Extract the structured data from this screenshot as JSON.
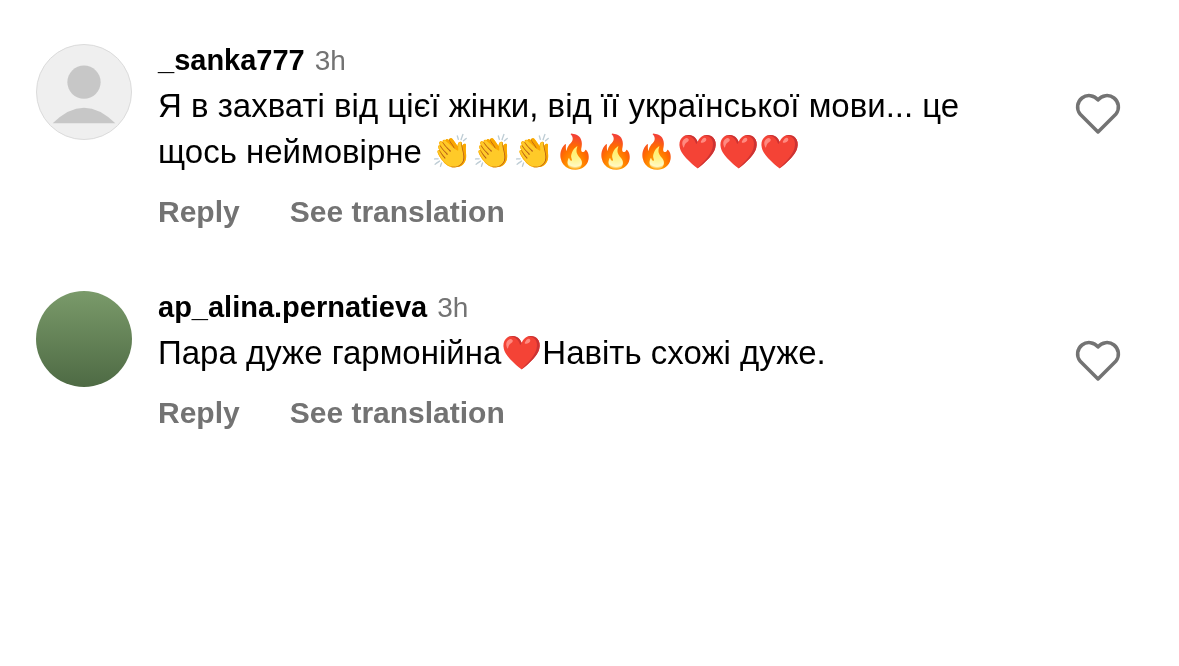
{
  "comments": [
    {
      "avatar": {
        "kind": "default"
      },
      "username": "_sanka777",
      "time": "3h",
      "text": "Я в захваті від цієї жінки, від її української мови... це щось неймовірне 👏👏👏🔥🔥🔥❤️❤️❤️",
      "actions": [
        "Reply",
        "See translation"
      ],
      "liked": false
    },
    {
      "avatar": {
        "kind": "photo"
      },
      "username": "ap_alina.pernatieva",
      "time": "3h",
      "text": "Пара дуже гармонійна❤️Навіть схожі дуже.",
      "actions": [
        "Reply",
        "See translation"
      ],
      "liked": false
    }
  ]
}
